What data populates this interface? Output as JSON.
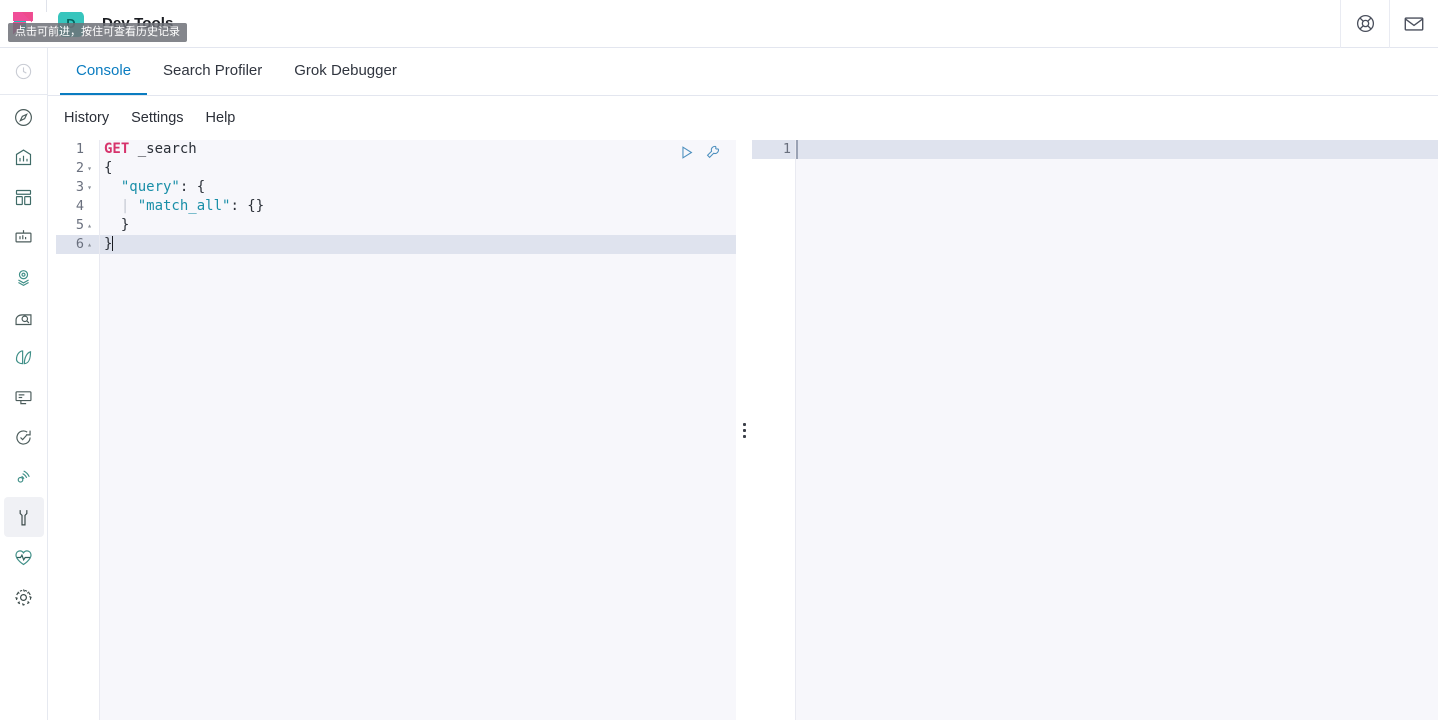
{
  "header": {
    "app_badge": "D",
    "title": "Dev Tools",
    "logo_icon": "elastic-logo",
    "help_icon": "lifebuoy-icon",
    "mail_icon": "envelope-icon"
  },
  "browser_tooltip": {
    "text": "点击可前进，按住可查看历史记录"
  },
  "sidebar": {
    "items": [
      {
        "icon": "recently-viewed-clock-icon",
        "name": "recently-viewed",
        "active": false
      },
      {
        "icon": "compass-discover-icon",
        "name": "discover",
        "active": false
      },
      {
        "icon": "bar-chart-visualize-icon",
        "name": "visualize",
        "active": false
      },
      {
        "icon": "dashboard-grid-icon",
        "name": "dashboard",
        "active": false
      },
      {
        "icon": "canvas-presentation-icon",
        "name": "canvas",
        "active": false
      },
      {
        "icon": "map-location-pin-icon",
        "name": "maps",
        "active": false
      },
      {
        "icon": "machine-learning-person-icon",
        "name": "machine-learning",
        "active": false
      },
      {
        "icon": "graph-leaves-icon",
        "name": "graph",
        "active": false
      },
      {
        "icon": "monitor-infrastructure-icon",
        "name": "infrastructure",
        "active": false
      },
      {
        "icon": "uptime-refresh-icon",
        "name": "uptime",
        "active": false
      },
      {
        "icon": "apm-broadcast-icon",
        "name": "apm",
        "active": false
      },
      {
        "icon": "wrench-devtools-icon",
        "name": "dev-tools",
        "active": true
      },
      {
        "icon": "heart-pulse-monitoring-icon",
        "name": "stack-monitoring",
        "active": false
      },
      {
        "icon": "gear-management-icon",
        "name": "management",
        "active": false
      }
    ]
  },
  "tabs": [
    {
      "label": "Console",
      "active": true
    },
    {
      "label": "Search Profiler",
      "active": false
    },
    {
      "label": "Grok Debugger",
      "active": false
    }
  ],
  "console_menu": [
    {
      "label": "History"
    },
    {
      "label": "Settings"
    },
    {
      "label": "Help"
    }
  ],
  "request_editor": {
    "actions": [
      {
        "icon": "play-send-request-icon",
        "name": "send-request-button"
      },
      {
        "icon": "wrench-context-menu-icon",
        "name": "request-actions-button"
      }
    ],
    "lines": [
      {
        "number": "1",
        "fold": "",
        "active": false,
        "tokens": [
          {
            "t": "method",
            "v": "GET"
          },
          {
            "t": "plain",
            "v": " _search"
          }
        ]
      },
      {
        "number": "2",
        "fold": "▾",
        "active": false,
        "tokens": [
          {
            "t": "punc",
            "v": "{"
          }
        ]
      },
      {
        "number": "3",
        "fold": "▾",
        "active": false,
        "tokens": [
          {
            "t": "plain",
            "v": "  "
          },
          {
            "t": "key",
            "v": "\"query\""
          },
          {
            "t": "punc",
            "v": ": {"
          }
        ]
      },
      {
        "number": "4",
        "fold": "",
        "active": false,
        "tokens": [
          {
            "t": "guide",
            "v": "  | "
          },
          {
            "t": "key",
            "v": "\"match_all\""
          },
          {
            "t": "punc",
            "v": ": {}"
          }
        ]
      },
      {
        "number": "5",
        "fold": "▴",
        "active": false,
        "tokens": [
          {
            "t": "punc",
            "v": "  }"
          }
        ]
      },
      {
        "number": "6",
        "fold": "▴",
        "active": true,
        "tokens": [
          {
            "t": "punc",
            "v": "}"
          },
          {
            "t": "caret",
            "v": ""
          }
        ]
      }
    ]
  },
  "response_editor": {
    "lines": [
      {
        "number": "1",
        "active": true,
        "text": ""
      }
    ]
  },
  "colors": {
    "accent_blue": "#0a7cc0",
    "elastic_pink": "#f04e98",
    "elastic_teal": "#00bfb3",
    "editor_bg": "#f7f7fb",
    "active_line": "#dfe3ee",
    "method_keyword": "#d6336c",
    "json_key": "#1a8fa8"
  }
}
